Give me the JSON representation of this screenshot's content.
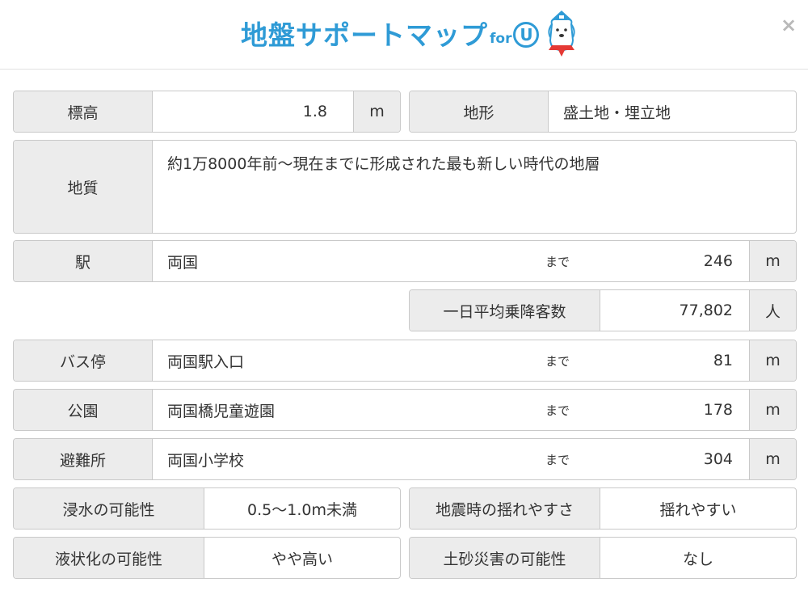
{
  "header": {
    "title": "地盤サポートマップ",
    "title_for": "for",
    "title_u": "U",
    "close": "×"
  },
  "elevation": {
    "label": "標高",
    "value": "1.8",
    "unit": "m"
  },
  "terrain": {
    "label": "地形",
    "value": "盛土地・埋立地"
  },
  "geology": {
    "label": "地質",
    "value": "約1万8000年前～現在までに形成された最も新しい時代の地層"
  },
  "station": {
    "label": "駅",
    "name": "両国",
    "made": "まで",
    "distance": "246",
    "unit": "m"
  },
  "passengers": {
    "label": "一日平均乗降客数",
    "value": "77,802",
    "unit": "人"
  },
  "bus": {
    "label": "バス停",
    "name": "両国駅入口",
    "made": "まで",
    "distance": "81",
    "unit": "m"
  },
  "park": {
    "label": "公園",
    "name": "両国橋児童遊園",
    "made": "まで",
    "distance": "178",
    "unit": "m"
  },
  "shelter": {
    "label": "避難所",
    "name": "両国小学校",
    "made": "まで",
    "distance": "304",
    "unit": "m"
  },
  "flood": {
    "label": "浸水の可能性",
    "value": "0.5～1.0m未満"
  },
  "quake": {
    "label": "地震時の揺れやすさ",
    "value": "揺れやすい"
  },
  "liquefaction": {
    "label": "液状化の可能性",
    "value": "やや高い"
  },
  "landslide": {
    "label": "土砂災害の可能性",
    "value": "なし"
  },
  "colors": {
    "accent": "#2f9bd6",
    "label_bg": "#ececec",
    "border": "#c9c9c9"
  }
}
